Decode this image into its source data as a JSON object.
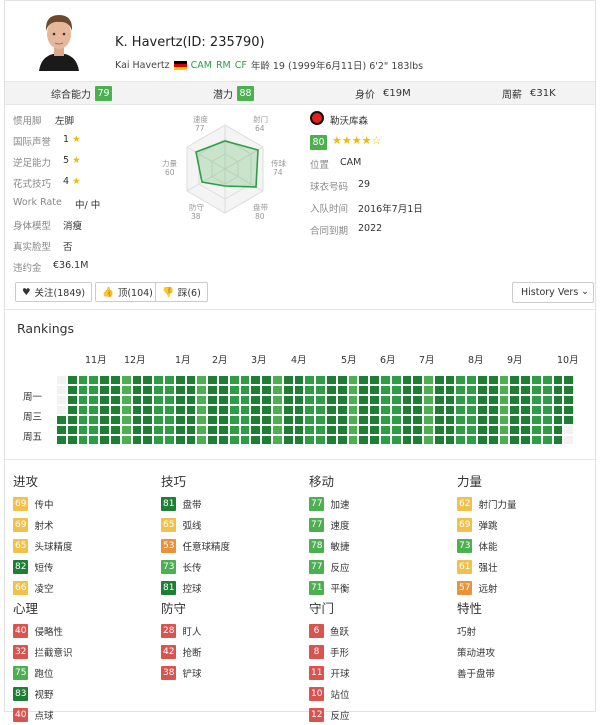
{
  "player": {
    "title": "K. Havertz(ID: 235790)",
    "full_name": "Kai Havertz",
    "positions": [
      "CAM",
      "RM",
      "CF"
    ],
    "age_text": "年龄 19 (1999年6月11日) 6'2\" 183lbs"
  },
  "summary": [
    {
      "label": "综合能力",
      "value": "79",
      "color": "green"
    },
    {
      "label": "潜力",
      "value": "88",
      "color": "green"
    },
    {
      "label": "身价",
      "value": "€19M"
    },
    {
      "label": "周薪",
      "value": "€31K"
    }
  ],
  "details": {
    "preferred_foot": {
      "label": "惯用脚",
      "value": "左脚"
    },
    "reputation": {
      "label": "国际声誉",
      "value": "1"
    },
    "weak_foot": {
      "label": "逆足能力",
      "value": "5"
    },
    "skill_moves": {
      "label": "花式技巧",
      "value": "4"
    },
    "work_rate": {
      "label": "Work Rate",
      "value": "中/ 中"
    },
    "body_type": {
      "label": "身体模型",
      "value": "消瘦"
    },
    "real_face": {
      "label": "真实脸型",
      "value": "否"
    },
    "release_clause": {
      "label": "违约金",
      "value": "€36.1M"
    }
  },
  "radar": {
    "labels": [
      "速度",
      "射门",
      "传球",
      "盘带",
      "防守",
      "力量"
    ],
    "values": [
      "77",
      "64",
      "74",
      "80",
      "38",
      "60"
    ]
  },
  "club": {
    "name": "勒沃库森",
    "rating": "80",
    "stars": "★★★★☆",
    "position": {
      "label": "位置",
      "value": "CAM"
    },
    "jersey": {
      "label": "球衣号码",
      "value": "29"
    },
    "joined": {
      "label": "入队时间",
      "value": "2016年7月1日"
    },
    "contract": {
      "label": "合同到期",
      "value": "2022"
    }
  },
  "actions": {
    "follow": "关注(1849)",
    "like": "顶(104)",
    "dislike": "踩(6)",
    "history": "History Versio"
  },
  "rankings": {
    "title": "Rankings",
    "months": [
      "11月",
      "12月",
      "1月",
      "2月",
      "3月",
      "4月",
      "5月",
      "6月",
      "7月",
      "8月",
      "9月",
      "10月"
    ],
    "day_labels": [
      "周一",
      "周三",
      "周五"
    ]
  },
  "categories": [
    {
      "name": "进攻",
      "attrs": [
        {
          "v": "69",
          "c": "y",
          "n": "传中"
        },
        {
          "v": "69",
          "c": "y",
          "n": "射术"
        },
        {
          "v": "65",
          "c": "y",
          "n": "头球精度"
        },
        {
          "v": "82",
          "c": "dg",
          "n": "短传"
        },
        {
          "v": "66",
          "c": "y",
          "n": "凌空"
        }
      ]
    },
    {
      "name": "技巧",
      "attrs": [
        {
          "v": "81",
          "c": "dg",
          "n": "盘带"
        },
        {
          "v": "65",
          "c": "y",
          "n": "弧线"
        },
        {
          "v": "53",
          "c": "o",
          "n": "任意球精度"
        },
        {
          "v": "73",
          "c": "g",
          "n": "长传"
        },
        {
          "v": "81",
          "c": "dg",
          "n": "控球"
        }
      ]
    },
    {
      "name": "移动",
      "attrs": [
        {
          "v": "77",
          "c": "g",
          "n": "加速"
        },
        {
          "v": "77",
          "c": "g",
          "n": "速度"
        },
        {
          "v": "78",
          "c": "g",
          "n": "敏捷"
        },
        {
          "v": "77",
          "c": "g",
          "n": "反应"
        },
        {
          "v": "71",
          "c": "g",
          "n": "平衡"
        }
      ]
    },
    {
      "name": "力量",
      "attrs": [
        {
          "v": "62",
          "c": "y",
          "n": "射门力量"
        },
        {
          "v": "69",
          "c": "y",
          "n": "弹跳"
        },
        {
          "v": "73",
          "c": "g",
          "n": "体能"
        },
        {
          "v": "61",
          "c": "y",
          "n": "强壮"
        },
        {
          "v": "57",
          "c": "o",
          "n": "远射"
        }
      ]
    },
    {
      "name": "心理",
      "attrs": [
        {
          "v": "40",
          "c": "r",
          "n": "侵略性"
        },
        {
          "v": "32",
          "c": "r",
          "n": "拦截意识"
        },
        {
          "v": "75",
          "c": "g",
          "n": "跑位"
        },
        {
          "v": "83",
          "c": "dg",
          "n": "视野"
        },
        {
          "v": "40",
          "c": "r",
          "n": "点球"
        }
      ]
    },
    {
      "name": "防守",
      "attrs": [
        {
          "v": "28",
          "c": "r",
          "n": "盯人"
        },
        {
          "v": "42",
          "c": "r",
          "n": "抢断"
        },
        {
          "v": "38",
          "c": "r",
          "n": "铲球"
        }
      ]
    },
    {
      "name": "守门",
      "attrs": [
        {
          "v": "6",
          "c": "r",
          "n": "鱼跃"
        },
        {
          "v": "8",
          "c": "r",
          "n": "手形"
        },
        {
          "v": "11",
          "c": "r",
          "n": "开球"
        },
        {
          "v": "10",
          "c": "r",
          "n": "站位"
        },
        {
          "v": "12",
          "c": "r",
          "n": "反应"
        }
      ]
    },
    {
      "name": "特性",
      "traits": [
        "巧射",
        "策动进攻",
        "善于盘带"
      ]
    }
  ],
  "colors": {
    "green": "#4caf50",
    "dark_green": "#1e7e34",
    "yellow": "#f0c14b",
    "orange": "#e8933c",
    "red": "#d9534f"
  }
}
